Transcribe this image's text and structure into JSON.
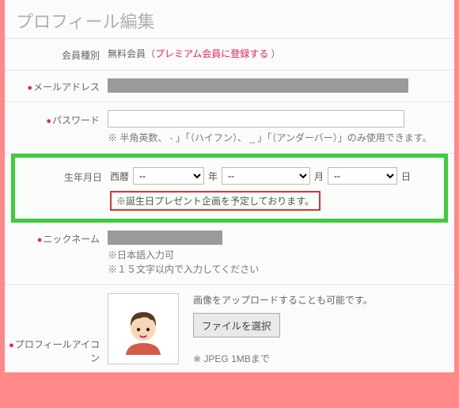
{
  "title": "プロフィール編集",
  "membership": {
    "label": "会員種別",
    "value": "無料会員",
    "premium_link": "プレミアム会員に登録する"
  },
  "email": {
    "label": "メールアドレス"
  },
  "password": {
    "label": "パスワード",
    "note": "※ 半角英数、 -  」「（ハイフン）、  _  」「（アンダーバー）」のみ使用できます。"
  },
  "dob": {
    "label": "生年月日",
    "era": "西暦",
    "year_value": "--",
    "year_suffix": "年",
    "month_value": "--",
    "month_suffix": "月",
    "day_value": "--",
    "day_suffix": "日",
    "note": "※誕生日プレゼント企画を予定しております。"
  },
  "nickname": {
    "label": "ニックネーム",
    "note1": "※日本語入力可",
    "note2": "※１５文字以内で入力してください"
  },
  "avatar": {
    "label": "プロフィールアイコン",
    "upload_text": "画像をアップロードすることも可能です。",
    "file_button": "ファイルを選択",
    "limit_note": "※ JPEG 1MBまで"
  }
}
